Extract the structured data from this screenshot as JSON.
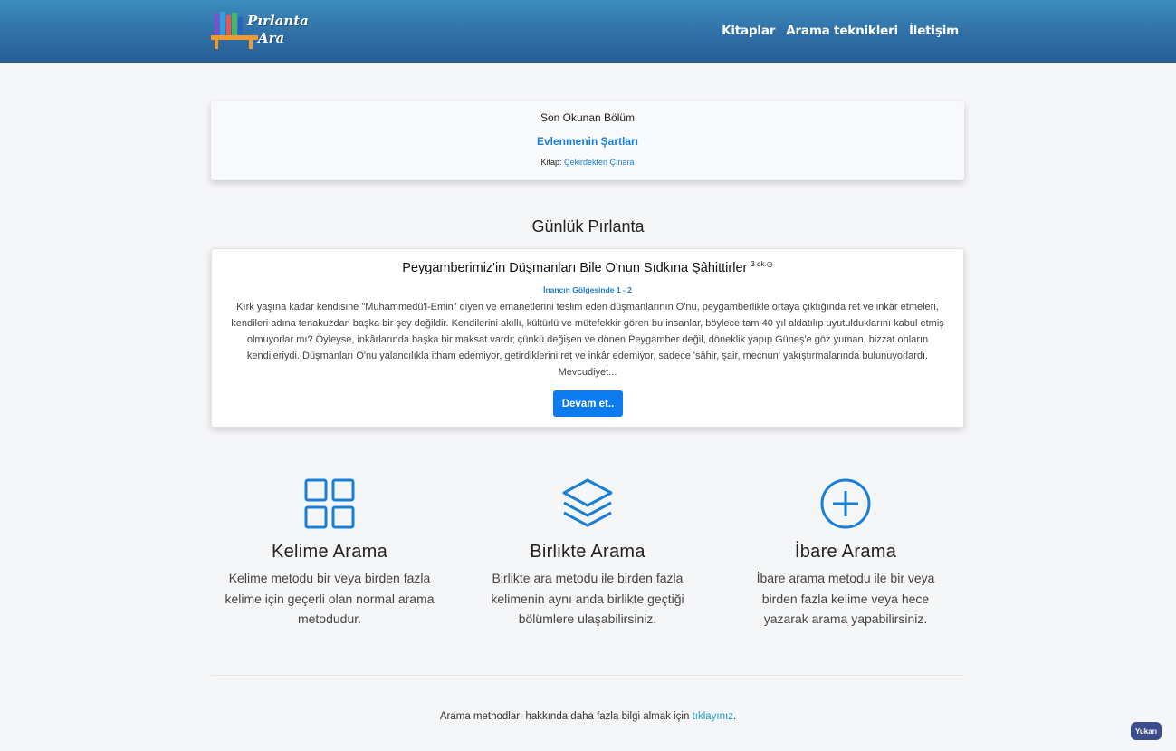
{
  "header": {
    "logo_line1": "Pırlanta",
    "logo_line2": "Ara",
    "nav": [
      "Kitaplar",
      "Arama teknikleri",
      "İletişim"
    ]
  },
  "last_read": {
    "title": "Son Okunan Bölüm",
    "chapter": "Evlenmenin Şartları",
    "book_label": "Kitap:",
    "book": "Çekirdekten Çınara"
  },
  "daily": {
    "heading": "Günlük Pırlanta",
    "title": "Peygamberimiz'in Düşmanları Bile O'nun Sıdkına Şâhittirler",
    "read_time": "3 dk.",
    "source": "İnancın Gölgesinde 1 - 2",
    "text": "Kırk yaşına kadar kendisine \"Muhammedü'l-Emin\" diyen ve emanetlerini teslim eden düşmanlarının O'nu, peygamberlikle ortaya çıktığında ret ve inkâr etmeleri, kendileri adına tenakuzdan başka bir şey değildir. Kendilerini akıllı, kültürlü ve mütefekkir gören bu insanlar, böylece tam 40 yıl aldatılıp uyutulduklarını kabul etmiş olmuyorlar mı? Öyleyse, inkârlarında başka bir maksat vardı; çünkü değişen ve dönen Peygamber değil, döneklik yapıp Güneş'e göz yuman, bizzat onların kendileriydi. Düşmanları O'nu yalancılıkla itham edemiyor, getirdiklerini ret ve inkâr edemiyor, sadece 'sâhir, şair, mecnun' yakıştırmalarında bulunuyorlardı. Mevcudiyet...",
    "button": "Devam et.."
  },
  "features": [
    {
      "icon": "grid-icon",
      "title": "Kelime Arama",
      "desc": "Kelime metodu bir veya birden fazla kelime için geçerli olan normal arama metodudur."
    },
    {
      "icon": "layers-icon",
      "title": "Birlikte Arama",
      "desc": "Birlikte ara metodu ile birden fazla kelimenin aynı anda birlikte geçtiği bölümlere ulaşabilirsiniz."
    },
    {
      "icon": "plus-circle-icon",
      "title": "İbare Arama",
      "desc": "İbare arama metodu ile bir veya birden fazla kelime veya hece yazarak arama yapabilirsiniz."
    }
  ],
  "footer": {
    "text": "Arama methodları hakkında daha fazla bilgi almak için",
    "link": "tıklayınız",
    "end": "."
  },
  "top_button": "Yukarı",
  "colors": {
    "accent": "#0d7bf0",
    "icon": "#1a7fd6",
    "header": "#2f6fa6"
  }
}
